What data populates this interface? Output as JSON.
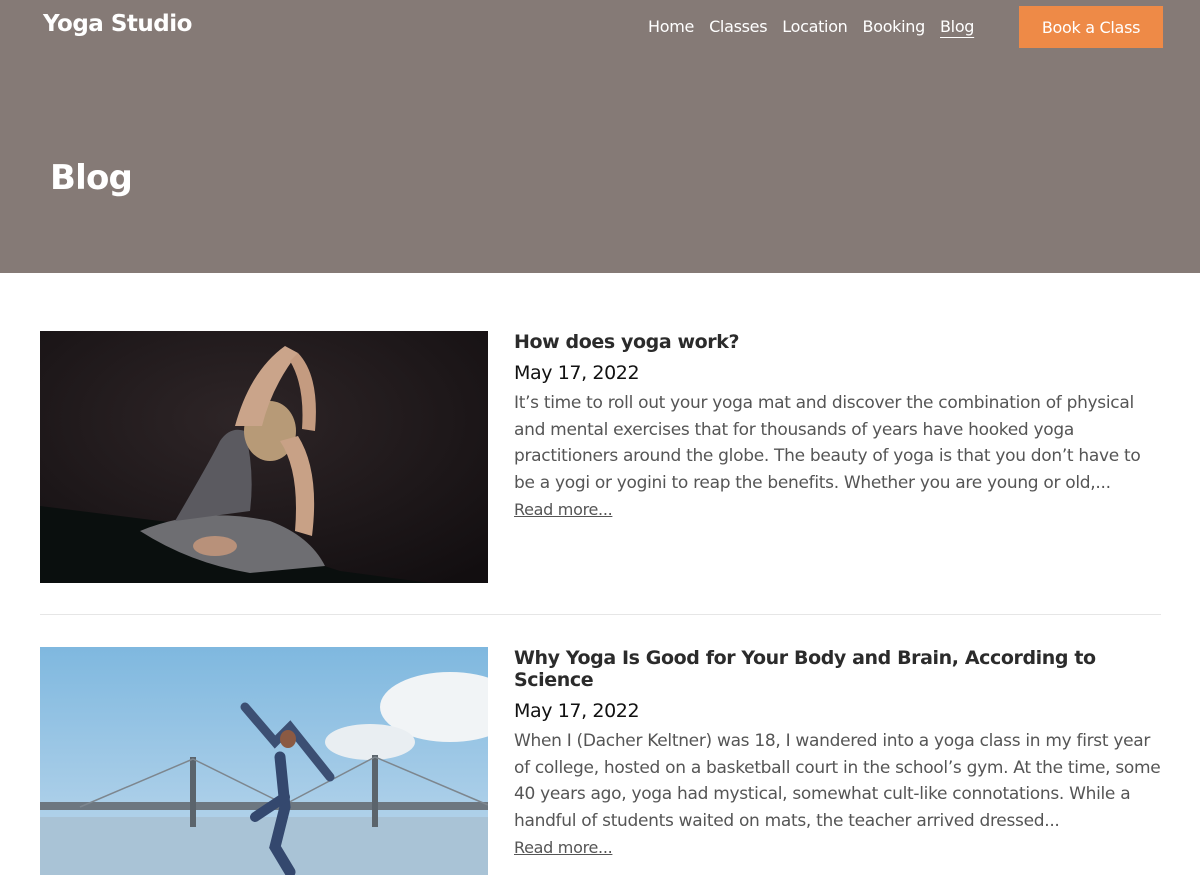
{
  "header": {
    "brand": "Yoga Studio",
    "nav": [
      {
        "label": "Home"
      },
      {
        "label": "Classes"
      },
      {
        "label": "Location"
      },
      {
        "label": "Booking"
      },
      {
        "label": "Blog",
        "active": true
      }
    ],
    "cta_label": "Book a Class",
    "accent_color": "#ee8a47",
    "hero_color": "#857a76"
  },
  "page_title": "Blog",
  "posts": [
    {
      "title": "How does yoga work?",
      "date": "May 17, 2022",
      "excerpt": "It’s time to roll out your yoga mat and discover the combination of physical and mental exercises that for thousands of years have hooked yoga practitioners around the globe. The beauty of yoga is that you don’t have to be a yogi or yogini to reap the benefits. Whether you are young or old,...",
      "read_more": "Read more...",
      "image": "photo-woman-yoga-pose-dark-background"
    },
    {
      "title": "Why Yoga Is Good for Your Body and Brain, According to Science",
      "date": "May 17, 2022",
      "excerpt": "When I (Dacher Keltner) was 18, I wandered into a yoga class in my first year of college, hosted on a basketball court in the school’s gym. At the time, some 40 years ago, yoga had mystical, somewhat cult-like connotations. While a handful of students waited on mats, the teacher arrived dressed...",
      "read_more": "Read more...",
      "image": "photo-woman-dancing-by-bridge"
    }
  ]
}
